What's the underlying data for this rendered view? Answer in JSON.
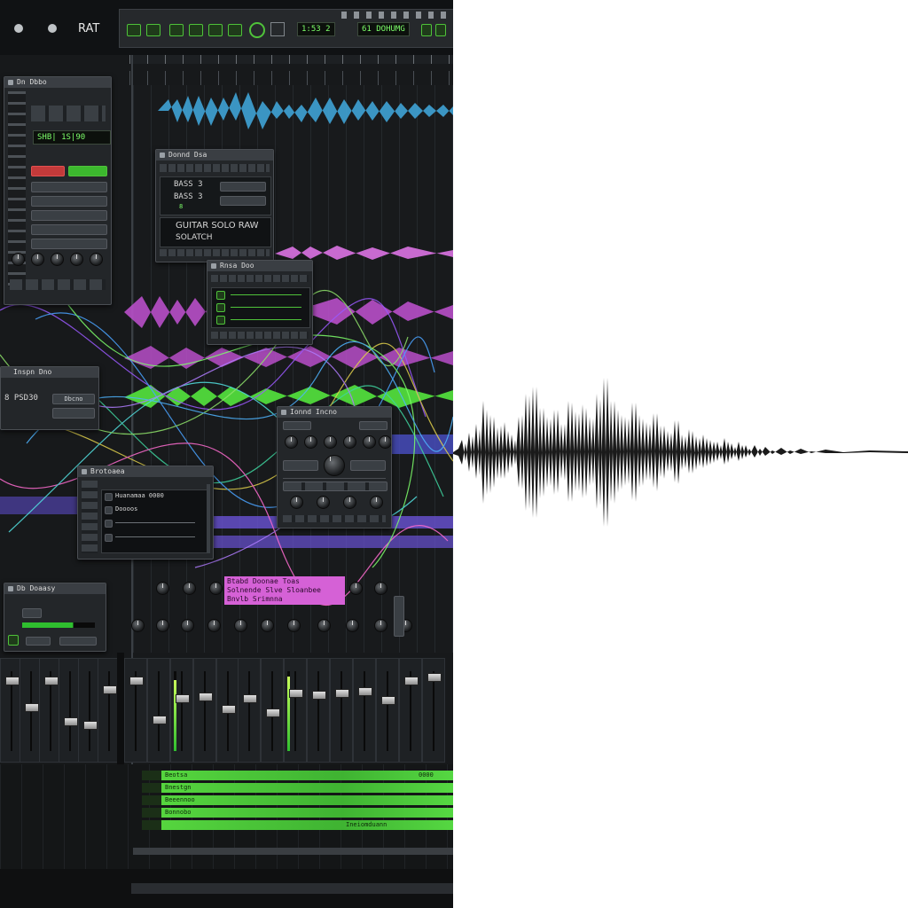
{
  "app": {
    "title": "RAT",
    "window_buttons": [
      "close-dot",
      "minimize-dot"
    ]
  },
  "transport": {
    "time_display": "1:53 2",
    "tempo_display": "61 DOHUMG",
    "accent_color": "#4fc23a"
  },
  "left_device": {
    "title": "Dn Dbbo",
    "lcd": "SHB| 1S|90",
    "record_label": "",
    "active_label": ""
  },
  "bass_panel": {
    "title": "Donnd Dsa",
    "line1": "BASS 3",
    "line2": "BASS 3",
    "line3": "8",
    "track_name": "GUITAR SOLO RAW",
    "track_sub": "SOLATCH"
  },
  "send_panel": {
    "title": "Rnsa Doo"
  },
  "left_bus_panel": {
    "title": "Inspn Dno",
    "line1": "8 PSD30",
    "button": "Dbcno"
  },
  "effect_panel": {
    "title": "Ionnd Incno"
  },
  "browser_panel": {
    "title": "Brotoaea",
    "items": [
      "Huanamaa 0000",
      "Doooos",
      "",
      ""
    ]
  },
  "meter_panel": {
    "title": "Db Doaasy"
  },
  "clip_label": {
    "line1": "Btabd Doonae  Toas",
    "line2": "Solnende  Slve Sloanbee",
    "line3": "Bnvlb  Srimnna"
  },
  "bottom_rows": [
    {
      "label": "Beotsa",
      "tail": "0000"
    },
    {
      "label": "Bnestgn",
      "tail": ""
    },
    {
      "label": "Beeennoo",
      "tail": ""
    },
    {
      "label": "Bonnobo",
      "tail": "Ineiomduann"
    }
  ],
  "track_colors": {
    "blue": "#3fa3d6",
    "pink": "#c86ad0",
    "magenta": "#b84fc9",
    "green": "#4ed13a",
    "violet": "#6a52d6"
  }
}
